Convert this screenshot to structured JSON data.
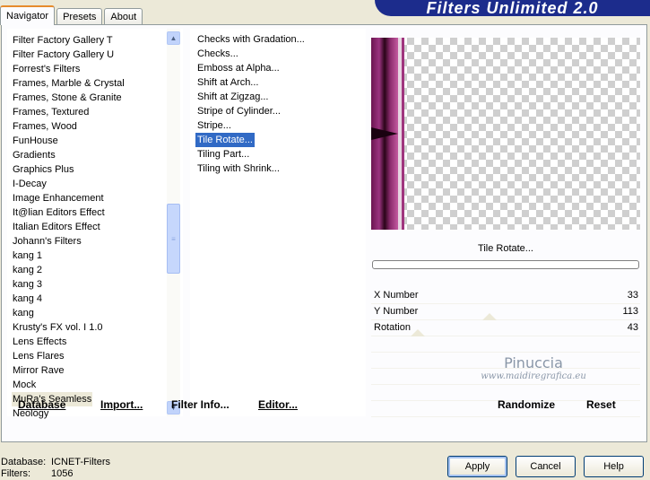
{
  "tabs": [
    {
      "label": "Navigator",
      "active": true
    },
    {
      "label": "Presets",
      "active": false
    },
    {
      "label": "About",
      "active": false
    }
  ],
  "banner": {
    "title": "Filters Unlimited 2.0"
  },
  "categories": {
    "items": [
      "Filter Factory Gallery T",
      "Filter Factory Gallery U",
      "Forrest's Filters",
      "Frames, Marble & Crystal",
      "Frames, Stone & Granite",
      "Frames, Textured",
      "Frames, Wood",
      "FunHouse",
      "Gradients",
      "Graphics Plus",
      "I-Decay",
      "Image Enhancement",
      "It@lian Editors Effect",
      "Italian Editors Effect",
      "Johann's Filters",
      "kang 1",
      "kang 2",
      "kang 3",
      "kang 4",
      "kang",
      "Krusty's FX vol. I 1.0",
      "Lens Effects",
      "Lens Flares",
      "Mirror Rave",
      "Mock",
      "MuRa's Seamless",
      "Neology"
    ],
    "selected_index": 25
  },
  "filters": {
    "items": [
      "Checks with Gradation...",
      "Checks...",
      "Emboss at Alpha...",
      "Shift at Arch...",
      "Shift at Zigzag...",
      "Stripe of Cylinder...",
      "Stripe...",
      "Tile Rotate...",
      "Tiling Part...",
      "Tiling with Shrink..."
    ],
    "selected_index": 7
  },
  "preview": {
    "filter_name": "Tile Rotate...",
    "stripe_colors": [
      "#5a1042",
      "#8c2a6e",
      "#c04090",
      "#2b0518",
      "#a0357e"
    ]
  },
  "params": [
    {
      "label": "X Number",
      "value": "33"
    },
    {
      "label": "Y Number",
      "value": "113"
    },
    {
      "label": "Rotation",
      "value": "43"
    }
  ],
  "watermark": {
    "line1": "Pinuccia",
    "line2": "www.maidiregrafica.eu"
  },
  "actions": {
    "database": "Database",
    "import": "Import...",
    "filter_info": "Filter Info...",
    "editor": "Editor...",
    "randomize": "Randomize",
    "reset": "Reset"
  },
  "status": {
    "database_label": "Database:",
    "database_value": "ICNET-Filters",
    "filters_label": "Filters:",
    "filters_value": "1056"
  },
  "buttons": {
    "apply": "Apply",
    "cancel": "Cancel",
    "help": "Help"
  }
}
